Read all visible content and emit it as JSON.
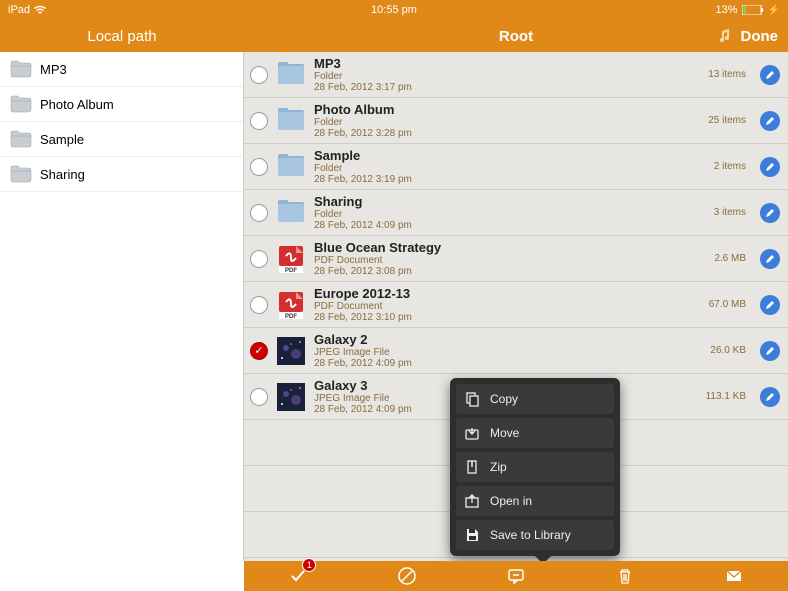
{
  "status": {
    "device": "iPad",
    "time": "10:55 pm",
    "battery": "13%"
  },
  "sidebar": {
    "title": "Local path",
    "items": [
      {
        "label": "MP3"
      },
      {
        "label": "Photo Album"
      },
      {
        "label": "Sample"
      },
      {
        "label": "Sharing"
      }
    ]
  },
  "header": {
    "title": "Root",
    "done": "Done"
  },
  "files": [
    {
      "name": "MP3",
      "type": "Folder",
      "date": "28 Feb, 2012 3:17 pm",
      "meta": "13 items",
      "icon": "folder",
      "selected": false
    },
    {
      "name": "Photo Album",
      "type": "Folder",
      "date": "28 Feb, 2012 3:28 pm",
      "meta": "25 items",
      "icon": "folder",
      "selected": false
    },
    {
      "name": "Sample",
      "type": "Folder",
      "date": "28 Feb, 2012 3:19 pm",
      "meta": "2 items",
      "icon": "folder",
      "selected": false
    },
    {
      "name": "Sharing",
      "type": "Folder",
      "date": "28 Feb, 2012 4:09 pm",
      "meta": "3 items",
      "icon": "folder",
      "selected": false
    },
    {
      "name": "Blue Ocean Strategy",
      "type": "PDF Document",
      "date": "28 Feb, 2012 3:08 pm",
      "meta": "2.6 MB",
      "icon": "pdf",
      "selected": false
    },
    {
      "name": "Europe 2012-13",
      "type": "PDF Document",
      "date": "28 Feb, 2012 3:10 pm",
      "meta": "67.0 MB",
      "icon": "pdf",
      "selected": false
    },
    {
      "name": "Galaxy 2",
      "type": "JPEG Image File",
      "date": "28 Feb, 2012 4:09 pm",
      "meta": "26.0 KB",
      "icon": "image",
      "selected": true
    },
    {
      "name": "Galaxy 3",
      "type": "JPEG Image File",
      "date": "28 Feb, 2012 4:09 pm",
      "meta": "113.1 KB",
      "icon": "image",
      "selected": false
    }
  ],
  "popup": {
    "items": [
      {
        "label": "Copy",
        "icon": "copy"
      },
      {
        "label": "Move",
        "icon": "move"
      },
      {
        "label": "Zip",
        "icon": "zip"
      },
      {
        "label": "Open in",
        "icon": "openin"
      },
      {
        "label": "Save to Library",
        "icon": "save"
      }
    ]
  },
  "toolbar": {
    "badge": "1"
  }
}
